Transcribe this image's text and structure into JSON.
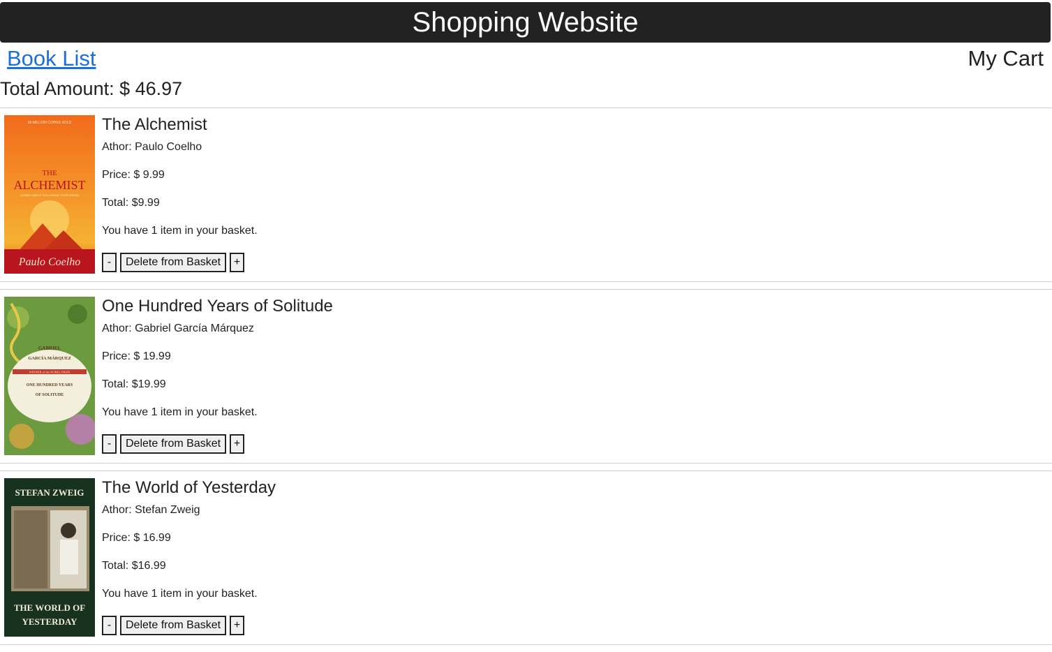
{
  "header": {
    "title": "Shopping Website"
  },
  "nav": {
    "book_list_label": "Book List",
    "my_cart_label": "My Cart"
  },
  "summary": {
    "total_amount": "Total Amount: $ 46.97"
  },
  "buttons": {
    "decrease": "-",
    "delete": "Delete from Basket",
    "increase": "+"
  },
  "items": [
    {
      "title": "The Alchemist",
      "author": "Athor: Paulo Coelho",
      "price": "Price: $ 9.99",
      "total": "Total: $9.99",
      "basket_msg": "You have 1 item in your basket.",
      "cover": {
        "top_text": "65 MILLION COPIES SOLD",
        "line1": "THE",
        "line2": "ALCHEMIST",
        "tagline": "A FABLE ABOUT FOLLOWING YOUR DREAM",
        "author": "Paulo Coelho"
      }
    },
    {
      "title": "One Hundred Years of Solitude",
      "author": "Athor: Gabriel García Márquez",
      "price": "Price: $ 19.99",
      "total": "Total: $19.99",
      "basket_msg": "You have 1 item in your basket.",
      "cover": {
        "line1": "GABRIEL",
        "line2": "GARCÍA MÁRQUEZ",
        "line3": "WINNER of the NOBEL PRIZE",
        "line4": "ONE HUNDRED YEARS",
        "line5": "OF SOLITUDE"
      }
    },
    {
      "title": "The World of Yesterday",
      "author": "Athor: Stefan Zweig",
      "price": "Price: $ 16.99",
      "total": "Total: $16.99",
      "basket_msg": "You have 1 item in your basket.",
      "cover": {
        "author": "STEFAN ZWEIG",
        "line1": "THE WORLD OF",
        "line2": "YESTERDAY"
      }
    }
  ],
  "colors": {
    "header_bg": "#222222",
    "link": "#1a6fd8",
    "alchemist_cover": "#f07a1f",
    "solitude_cover": "#6c9a3e",
    "zweig_cover": "#17331f"
  }
}
